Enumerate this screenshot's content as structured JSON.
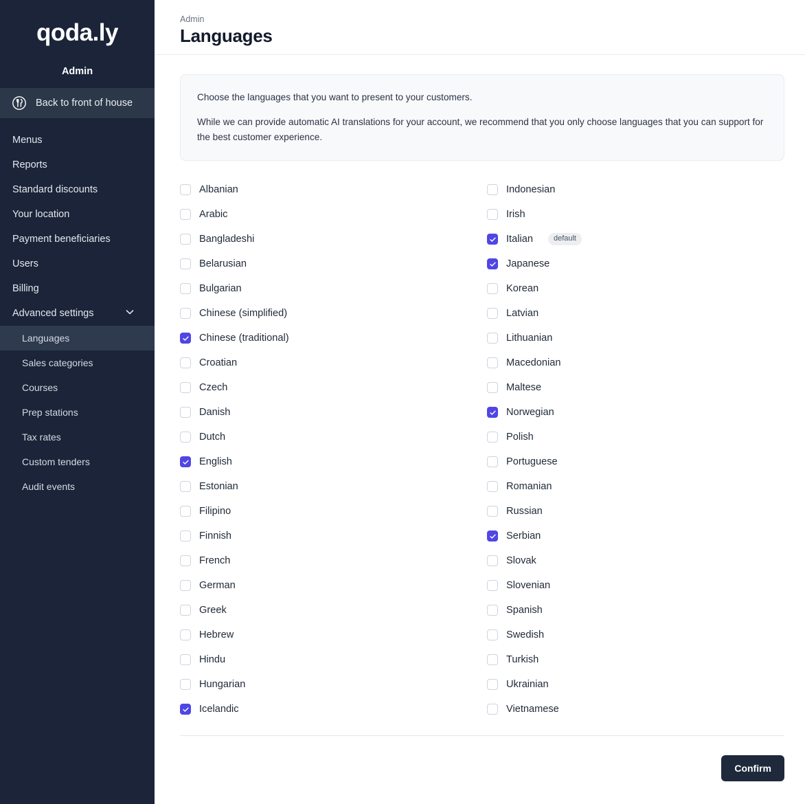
{
  "sidebar": {
    "brand": "qoda.ly",
    "admin_label": "Admin",
    "back_link": {
      "label": "Back to front of house",
      "icon": "restaurant-fork-spoon-icon"
    },
    "nav": [
      {
        "label": "Menus",
        "active": false,
        "sub": false
      },
      {
        "label": "Reports",
        "active": false,
        "sub": false
      },
      {
        "label": "Standard discounts",
        "active": false,
        "sub": false
      },
      {
        "label": "Your location",
        "active": false,
        "sub": false
      },
      {
        "label": "Payment beneficiaries",
        "active": false,
        "sub": false
      },
      {
        "label": "Users",
        "active": false,
        "sub": false
      },
      {
        "label": "Billing",
        "active": false,
        "sub": false
      },
      {
        "label": "Advanced settings",
        "active": false,
        "sub": false,
        "chevron": "chevron-down-icon"
      },
      {
        "label": "Languages",
        "active": true,
        "sub": true
      },
      {
        "label": "Sales categories",
        "active": false,
        "sub": true
      },
      {
        "label": "Courses",
        "active": false,
        "sub": true
      },
      {
        "label": "Prep stations",
        "active": false,
        "sub": true
      },
      {
        "label": "Tax rates",
        "active": false,
        "sub": true
      },
      {
        "label": "Custom tenders",
        "active": false,
        "sub": true
      },
      {
        "label": "Audit events",
        "active": false,
        "sub": true
      }
    ]
  },
  "header": {
    "breadcrumb": "Admin",
    "title": "Languages"
  },
  "info": {
    "line1": "Choose the languages that you want to present to your customers.",
    "line2": "While we can provide automatic AI translations for your account, we recommend that you only choose languages that you can support for the best customer experience."
  },
  "languages": {
    "left": [
      {
        "label": "Albanian",
        "checked": false
      },
      {
        "label": "Arabic",
        "checked": false
      },
      {
        "label": "Bangladeshi",
        "checked": false
      },
      {
        "label": "Belarusian",
        "checked": false
      },
      {
        "label": "Bulgarian",
        "checked": false
      },
      {
        "label": "Chinese (simplified)",
        "checked": false
      },
      {
        "label": "Chinese (traditional)",
        "checked": true
      },
      {
        "label": "Croatian",
        "checked": false
      },
      {
        "label": "Czech",
        "checked": false
      },
      {
        "label": "Danish",
        "checked": false
      },
      {
        "label": "Dutch",
        "checked": false
      },
      {
        "label": "English",
        "checked": true
      },
      {
        "label": "Estonian",
        "checked": false
      },
      {
        "label": "Filipino",
        "checked": false
      },
      {
        "label": "Finnish",
        "checked": false
      },
      {
        "label": "French",
        "checked": false
      },
      {
        "label": "German",
        "checked": false
      },
      {
        "label": "Greek",
        "checked": false
      },
      {
        "label": "Hebrew",
        "checked": false
      },
      {
        "label": "Hindu",
        "checked": false
      },
      {
        "label": "Hungarian",
        "checked": false
      },
      {
        "label": "Icelandic",
        "checked": true
      }
    ],
    "right": [
      {
        "label": "Indonesian",
        "checked": false
      },
      {
        "label": "Irish",
        "checked": false
      },
      {
        "label": "Italian",
        "checked": true,
        "badge": "default"
      },
      {
        "label": "Japanese",
        "checked": true
      },
      {
        "label": "Korean",
        "checked": false
      },
      {
        "label": "Latvian",
        "checked": false
      },
      {
        "label": "Lithuanian",
        "checked": false
      },
      {
        "label": "Macedonian",
        "checked": false
      },
      {
        "label": "Maltese",
        "checked": false
      },
      {
        "label": "Norwegian",
        "checked": true
      },
      {
        "label": "Polish",
        "checked": false
      },
      {
        "label": "Portuguese",
        "checked": false
      },
      {
        "label": "Romanian",
        "checked": false
      },
      {
        "label": "Russian",
        "checked": false
      },
      {
        "label": "Serbian",
        "checked": true
      },
      {
        "label": "Slovak",
        "checked": false
      },
      {
        "label": "Slovenian",
        "checked": false
      },
      {
        "label": "Spanish",
        "checked": false
      },
      {
        "label": "Swedish",
        "checked": false
      },
      {
        "label": "Turkish",
        "checked": false
      },
      {
        "label": "Ukrainian",
        "checked": false
      },
      {
        "label": "Vietnamese",
        "checked": false
      }
    ]
  },
  "footer": {
    "confirm_label": "Confirm"
  },
  "colors": {
    "sidebar_bg": "#1b2438",
    "sidebar_active": "#2e3a4d",
    "checkbox_accent": "#4f46e5",
    "confirm_bg": "#1e293b",
    "info_bg": "#f8f9fb"
  }
}
